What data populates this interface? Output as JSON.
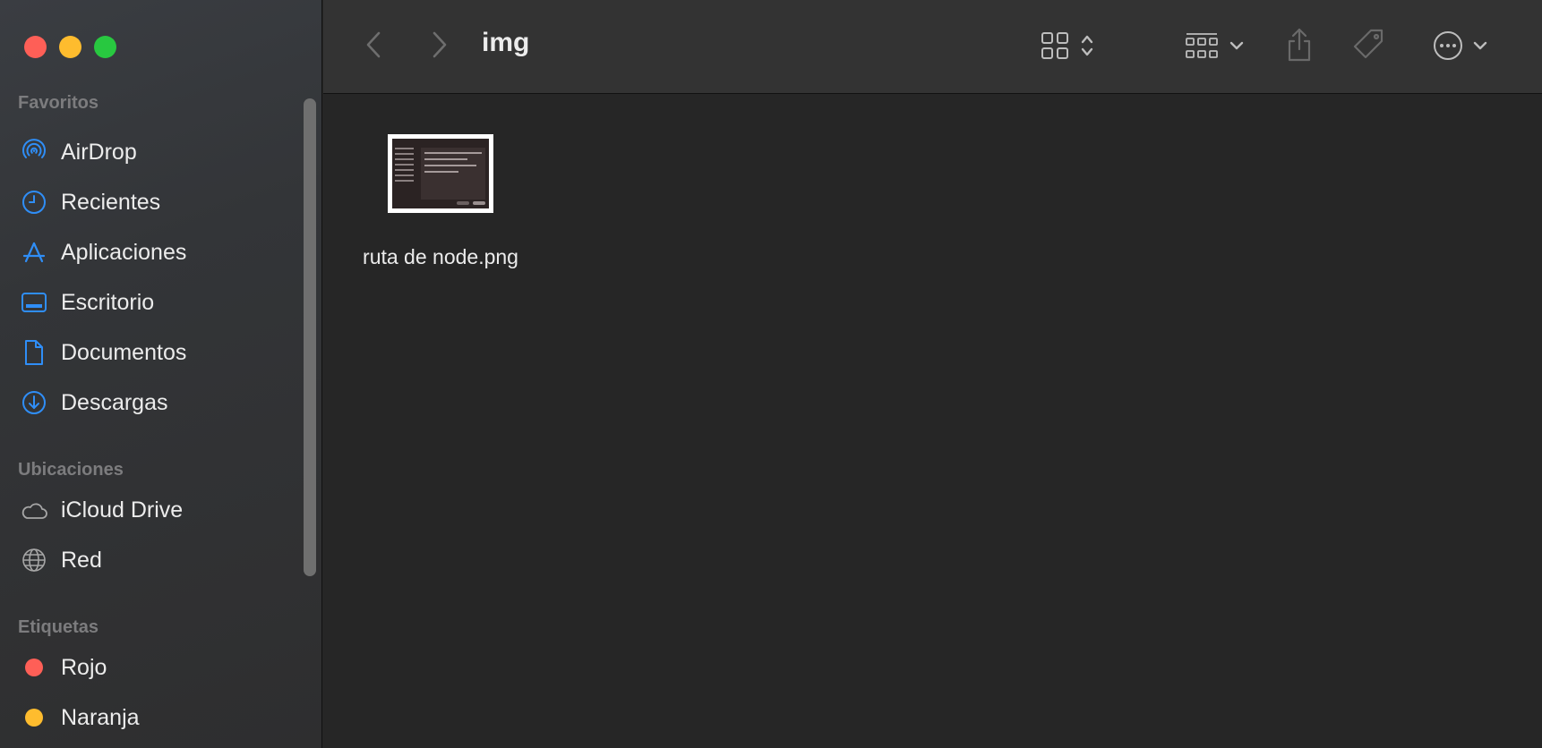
{
  "window": {
    "title": "img"
  },
  "sidebar": {
    "favorites_title": "Favoritos",
    "favorites": [
      {
        "label": "AirDrop",
        "icon": "airdrop-icon"
      },
      {
        "label": "Recientes",
        "icon": "clock-icon"
      },
      {
        "label": "Aplicaciones",
        "icon": "applications-icon"
      },
      {
        "label": "Escritorio",
        "icon": "desktop-icon"
      },
      {
        "label": "Documentos",
        "icon": "document-icon"
      },
      {
        "label": "Descargas",
        "icon": "download-icon"
      }
    ],
    "locations_title": "Ubicaciones",
    "locations": [
      {
        "label": "iCloud Drive",
        "icon": "cloud-icon"
      },
      {
        "label": "Red",
        "icon": "globe-icon"
      }
    ],
    "tags_title": "Etiquetas",
    "tags": [
      {
        "label": "Rojo",
        "color": "#fe5f57"
      },
      {
        "label": "Naranja",
        "color": "#febc2e"
      }
    ]
  },
  "toolbar": {
    "back": "chevron-left-icon",
    "forward": "chevron-right-icon",
    "view_mode": "icon-grid-icon",
    "group": "group-grid-icon",
    "share": "share-icon",
    "tag": "tag-icon",
    "more": "ellipsis-circle-icon"
  },
  "files": [
    {
      "name": "ruta de node.png"
    }
  ],
  "colors": {
    "accent": "#2f8ef7",
    "sidebar_bg": "#333538",
    "content_bg": "#262626"
  }
}
